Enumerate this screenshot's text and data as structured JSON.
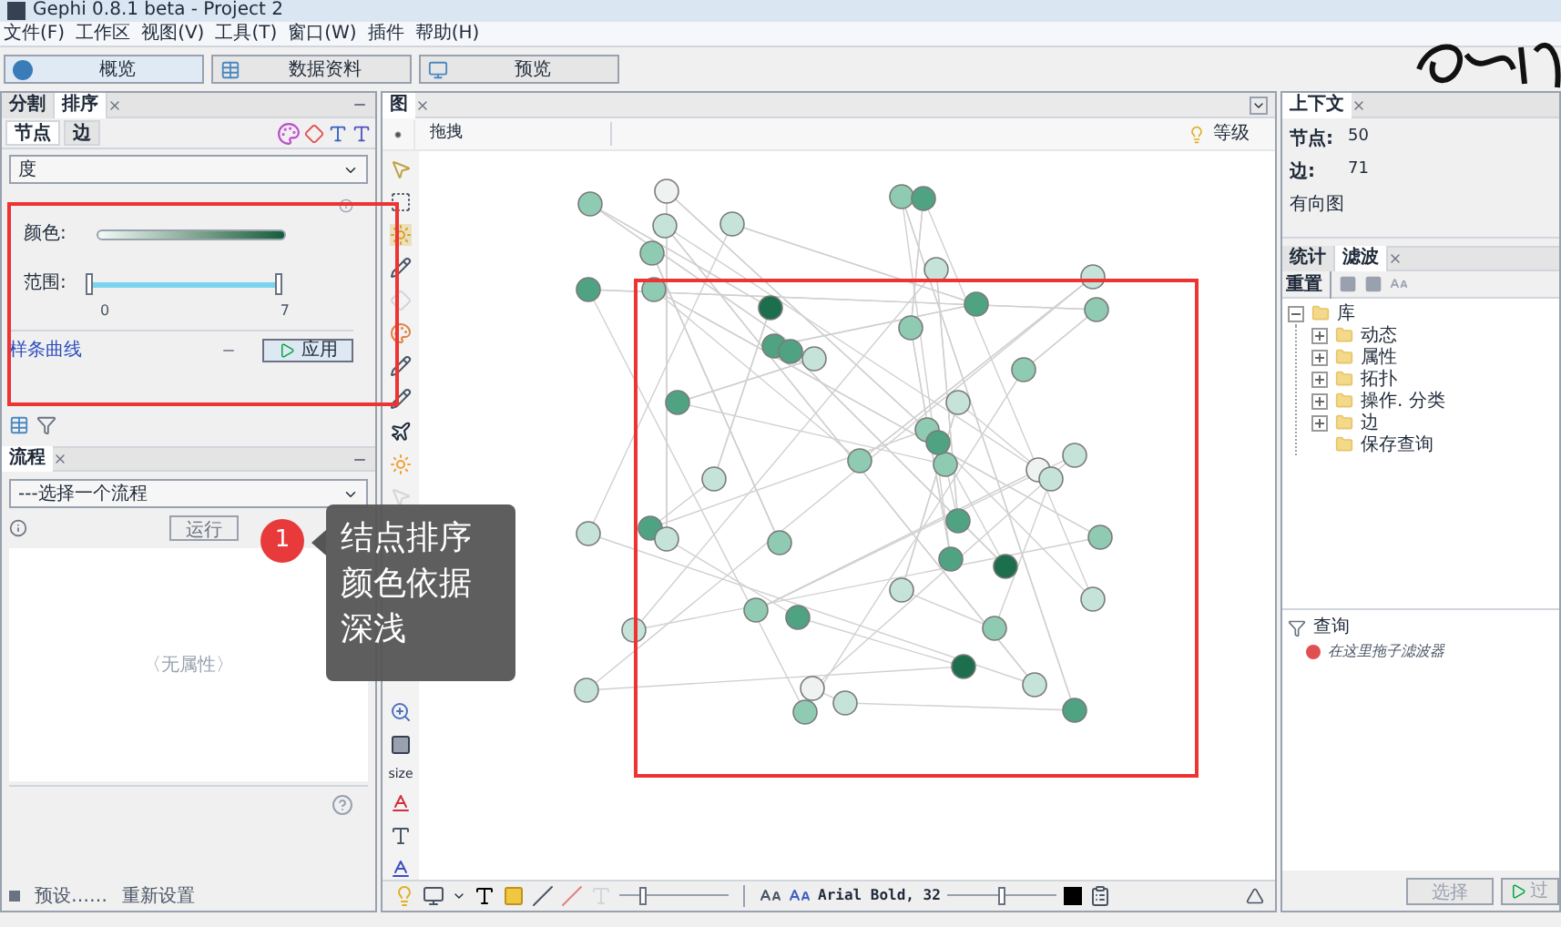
{
  "window": {
    "title": "Gephi 0.8.1 beta - Project 2"
  },
  "menu": [
    "文件(F)",
    "工作区",
    "视图(V)",
    "工具(T)",
    "窗口(W)",
    "插件",
    "帮助(H)"
  ],
  "workspaces": [
    {
      "label": "概览",
      "selected": true
    },
    {
      "label": "数据资料",
      "selected": false
    },
    {
      "label": "预览",
      "selected": false
    }
  ],
  "ranking_panel": {
    "tabs": [
      {
        "label": "分割",
        "selected": false
      },
      {
        "label": "排序",
        "selected": true
      }
    ],
    "element_tabs": [
      {
        "label": "节点",
        "selected": true
      },
      {
        "label": "边",
        "selected": false
      }
    ],
    "parameter": "度",
    "color_label": "颜色:",
    "range_label": "范围:",
    "range_min": "0",
    "range_max": "7",
    "range_thumbs": [
      {
        "level": 0
      },
      {
        "level": 1
      }
    ],
    "spline_link": "样条曲线",
    "apply_button": "应用"
  },
  "workflow_panel": {
    "tab": "流程",
    "select": "---选择一个流程",
    "run_button": "运行",
    "empty_text": "〈无属性〉",
    "presets": "预设……",
    "reset": "重新设置"
  },
  "graph_panel": {
    "tab": "图",
    "toolbar_label": "拖拽",
    "rank_label": "等级",
    "size_tool": "size",
    "label_font": "Arial Bold, 32",
    "sliders": [
      {
        "level": 0.2
      },
      {
        "level": 0.5
      }
    ]
  },
  "context_panel": {
    "tab": "上下文",
    "rows": [
      {
        "label": "节点:",
        "value": "50"
      },
      {
        "label": "边:",
        "value": "71"
      }
    ],
    "graph_type": "有向图"
  },
  "filter_panel": {
    "tabs": [
      {
        "label": "统计",
        "selected": false
      },
      {
        "label": "滤波",
        "selected": true
      }
    ],
    "reset": "重置",
    "tree": [
      {
        "label": "库",
        "expanded": true,
        "children": [
          {
            "label": "动态",
            "expanded": false
          },
          {
            "label": "属性",
            "expanded": false
          },
          {
            "label": "拓扑",
            "expanded": false
          },
          {
            "label": "操作. 分类",
            "expanded": false
          },
          {
            "label": "边",
            "expanded": false
          },
          {
            "label": "保存查询"
          }
        ]
      }
    ],
    "query_label": "查询",
    "query_hint": "在这里拖子滤波器",
    "select_button": "选择",
    "filter_button": "过"
  },
  "callout": {
    "number": "1",
    "lines": [
      "结点排序",
      "颜色依据",
      "深浅"
    ]
  }
}
